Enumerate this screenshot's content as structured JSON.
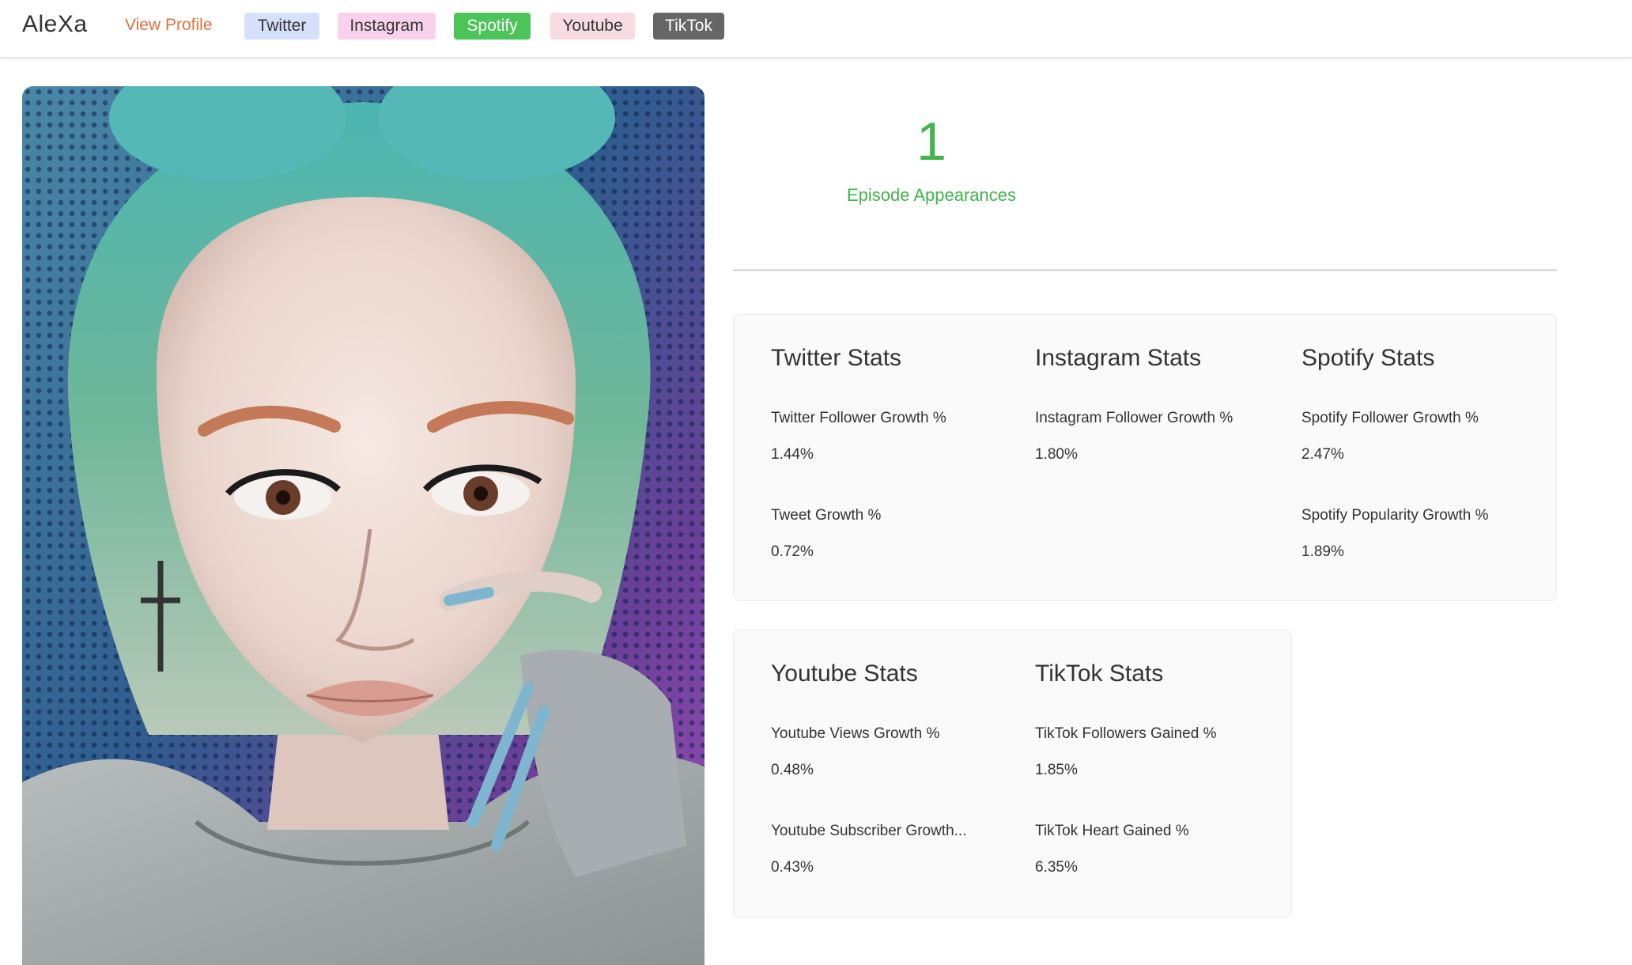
{
  "header": {
    "brand": "AleXa",
    "view_profile": "View Profile",
    "tags": {
      "twitter": "Twitter",
      "instagram": "Instagram",
      "spotify": "Spotify",
      "youtube": "Youtube",
      "tiktok": "TikTok"
    }
  },
  "colors": {
    "accent_green": "#3fb54a",
    "link_orange": "#e0703a",
    "twitter_tag": "#d5e0fb",
    "instagram_tag": "#f8d2ec",
    "spotify_tag": "#4cc45a",
    "youtube_tag": "#f9dbe3",
    "tiktok_tag": "#666666"
  },
  "episodes": {
    "count": "1",
    "label": "Episode Appearances"
  },
  "stats": {
    "twitter": {
      "title": "Twitter Stats",
      "metrics": [
        {
          "label": "Twitter Follower Growth %",
          "value": "1.44%"
        },
        {
          "label": "Tweet Growth %",
          "value": "0.72%"
        }
      ]
    },
    "instagram": {
      "title": "Instagram Stats",
      "metrics": [
        {
          "label": "Instagram Follower Growth %",
          "value": "1.80%"
        }
      ]
    },
    "spotify": {
      "title": "Spotify Stats",
      "metrics": [
        {
          "label": "Spotify Follower Growth %",
          "value": "2.47%"
        },
        {
          "label": "Spotify Popularity Growth %",
          "value": "1.89%"
        }
      ]
    },
    "youtube": {
      "title": "Youtube Stats",
      "metrics": [
        {
          "label": "Youtube Views Growth %",
          "value": "0.48%"
        },
        {
          "label": "Youtube Subscriber Growth...",
          "value": "0.43%"
        }
      ]
    },
    "tiktok": {
      "title": "TikTok Stats",
      "metrics": [
        {
          "label": "TikTok Followers Gained %",
          "value": "1.85%"
        },
        {
          "label": "TikTok Heart Gained %",
          "value": "6.35%"
        }
      ]
    }
  }
}
